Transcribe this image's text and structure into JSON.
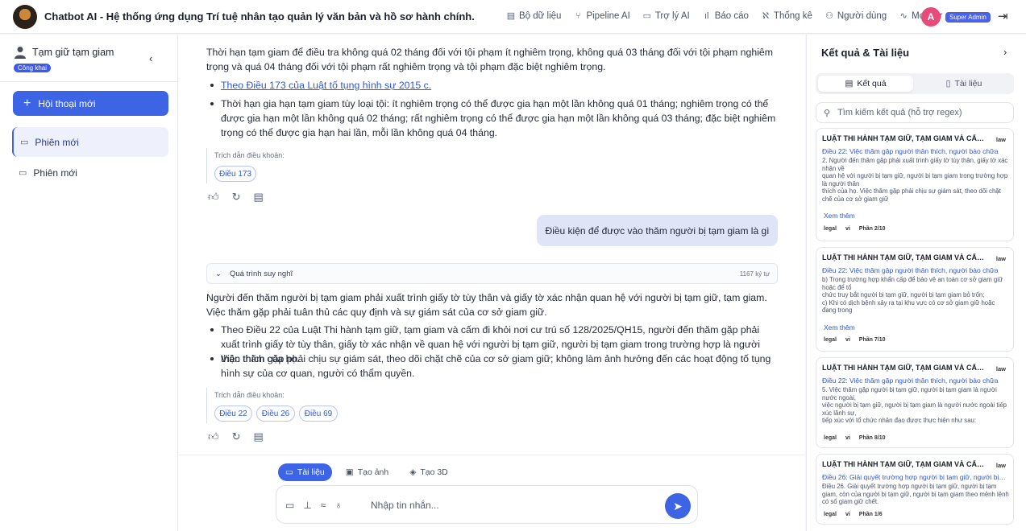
{
  "header": {
    "app_title": "Chatbot AI - Hệ thống ứng dụng Trí tuệ nhân tạo quản lý văn bản và hồ sơ hành chính.",
    "nav": [
      {
        "label": "Bộ dữ liệu",
        "icon": "database-icon"
      },
      {
        "label": "Pipeline AI",
        "icon": "pipeline-icon"
      },
      {
        "label": "Trợ lý AI",
        "icon": "chat-icon"
      },
      {
        "label": "Báo cáo",
        "icon": "bar-chart-icon"
      },
      {
        "label": "Thống kê",
        "icon": "stats-icon"
      },
      {
        "label": "Người dùng",
        "icon": "users-icon"
      },
      {
        "label": "Monitor",
        "icon": "activity-icon"
      }
    ],
    "avatar_letter": "A",
    "role": "Super Admin"
  },
  "sidebar": {
    "title": "Tạm giữ tạm giam",
    "visibility": "Công khai",
    "new_chat": "Hội thoại mới",
    "sessions": [
      {
        "label": "Phiên mới",
        "active": true
      },
      {
        "label": "Phiên mới",
        "active": false
      }
    ]
  },
  "conversation": {
    "msg1": {
      "para": "Thời hạn tạm giam để điều tra không quá 02 tháng đối với tội phạm ít nghiêm trọng, không quá 03 tháng đối với tội phạm nghiêm trọng và quá 04 tháng đối với tội phạm rất nghiêm trọng và tội phạm đặc biệt nghiêm trọng.",
      "bullet1": "Theo Điều 173 của Luật tố tụng hình sự 2015 c.",
      "bullet2": "Thời hạn gia hạn tạm giam tùy loại tội: ít nghiêm trọng có thể được gia hạn một lần không quá 01 tháng; nghiêm trọng có thể được gia hạn một lần không quá 02 tháng; rất nghiêm trọng có thể được gia hạn một lần không quá 03 tháng; đặc biệt nghiêm trọng có thể được gia hạn hai lần, mỗi lần không quá 04 tháng.",
      "cite_label": "Trích dẫn điều khoản:",
      "cites": [
        "Điều 173"
      ]
    },
    "user_msg": "Điều kiện để được vào thăm người bị tạm giam là gì",
    "thinking": {
      "label": "Quá trình suy nghĩ",
      "chars": "1167 ký tự"
    },
    "msg2": {
      "para": "Người đến thăm người bị tạm giam phải xuất trình giấy tờ tùy thân và giấy tờ xác nhận quan hệ với người bị tạm giữ, tạm giam. Việc thăm gặp phải tuân thủ các quy định và sự giám sát của cơ sở giam giữ.",
      "bullet1": "Theo Điều 22 của Luật Thi hành tạm giữ, tạm giam và cấm đi khỏi nơi cư trú số 128/2025/QH15, người đến thăm gặp phải xuất trình giấy tờ tùy thân, giấy tờ xác nhận về quan hệ với người bị tạm giữ, người bị tạm giam trong trường hợp là người thân thích của họ.",
      "bullet2": "Việc thăm gặp phải chịu sự giám sát, theo dõi chặt chẽ của cơ sở giam giữ; không làm ảnh hưởng đến các hoạt động tố tụng hình sự của cơ quan, người có thẩm quyền.",
      "cite_label": "Trích dẫn điều khoản:",
      "cites": [
        "Điều 22",
        "Điều 26",
        "Điều 69"
      ]
    }
  },
  "composer": {
    "modes": [
      {
        "label": "Tài liệu",
        "active": true
      },
      {
        "label": "Tạo ảnh",
        "active": false
      },
      {
        "label": "Tạo 3D",
        "active": false
      }
    ],
    "placeholder": "Nhập tin nhắn..."
  },
  "results": {
    "title": "Kết quả & Tài liệu",
    "tabs": [
      "Kết quả",
      "Tài liệu"
    ],
    "search_placeholder": "Tìm kiếm kết quả (hỗ trợ regex)",
    "more_label": "Xem thêm",
    "cards": [
      {
        "title": "LUẬT THI HÀNH TẠM GIỮ, TẠM GIAM VÀ CẤM ĐI KHỎI NƠI CƯ TRÚ",
        "type": "law",
        "subtitle": "Điều 22: Việc thăm gặp người thân thích, người bào chữa",
        "body": "2. Người đến thăm gặp phải xuất trình giấy tờ tùy thân, giấy tờ xác nhận về\nquan hệ với người bị tạm giữ, người bị tạm giam trong trường hợp là người thân\nthích của họ. Việc thăm gặp phải chịu sự giám sát, theo dõi chặt chẽ của cơ sở giam giữ",
        "show_more": true,
        "tag1": "legal",
        "tag2": "vi",
        "part": "Phần 2/10"
      },
      {
        "title": "LUẬT THI HÀNH TẠM GIỮ, TẠM GIAM VÀ CẤM ĐI KHỎI NƠI CƯ TRÚ",
        "type": "law",
        "subtitle": "Điều 22: Việc thăm gặp người thân thích, người bào chữa",
        "body": "b) Trong trường hợp khẩn cấp để bảo vệ an toàn cơ sở giam giữ hoặc để tổ\nchức truy bắt người bị tạm giữ, người bị tạm giam bỏ trốn;\nc) Khi có dịch bệnh xảy ra tại khu vực có cơ sở giam giữ hoặc đang trong",
        "show_more": true,
        "tag1": "legal",
        "tag2": "vi",
        "part": "Phần 7/10"
      },
      {
        "title": "LUẬT THI HÀNH TẠM GIỮ, TẠM GIAM VÀ CẤM ĐI KHỎI NƠI CƯ TRÚ",
        "type": "law",
        "subtitle": "Điều 22: Việc thăm gặp người thân thích, người bào chữa",
        "body": "5. Việc thăm gặp người bị tạm giữ, người bị tạm giam là người nước ngoài,\nviệc người bị tạm giữ, người bị tạm giam là người nước ngoài tiếp xúc lãnh sự,\ntiếp xúc với tổ chức nhân đạo được thực hiện như sau:",
        "show_more": false,
        "tag1": "legal",
        "tag2": "vi",
        "part": "Phần 8/10"
      },
      {
        "title": "LUẬT THI HÀNH TẠM GIỮ, TẠM GIAM VÀ CẤM ĐI KHỎI NƠI CƯ TRÚ",
        "type": "law",
        "subtitle": "Điều 26: Giải quyết trường hợp người bị tạm giữ, người bị tạm giam chết",
        "body": "Điều 26. Giải quyết trường hợp người bị tạm giữ, người bị tạm giam, còn của người bị tạm giữ, người bị tạm giam theo mệnh lệnh có số giam giữ chết.",
        "show_more": false,
        "tag1": "legal",
        "tag2": "vi",
        "part": "Phần 1/6"
      }
    ]
  }
}
